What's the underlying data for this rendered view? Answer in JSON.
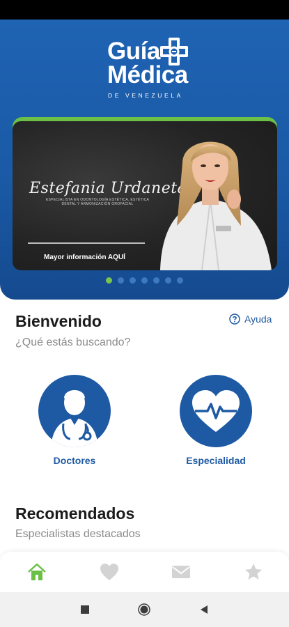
{
  "brand": {
    "line1": "Guía",
    "line2": "Médica",
    "subtitle": "DE VENEZUELA"
  },
  "banner": {
    "name": "Estefania Urdaneta",
    "specialty": "ESPECIALISTA EN ODONTOLOGÍA ESTÉTICA, ESTÉTICA DENTAL Y ARMONIZACIÓN OROFACIAL",
    "cta": "Mayor información AQUÍ"
  },
  "carousel": {
    "count": 7,
    "active_index": 0
  },
  "home": {
    "title": "Bienvenido",
    "subtitle": "¿Qué estás buscando?",
    "help_label": "Ayuda"
  },
  "categories": [
    {
      "label": "Doctores",
      "icon": "doctor-icon"
    },
    {
      "label": "Especialidad",
      "icon": "heart-pulse-icon"
    }
  ],
  "recommended": {
    "title": "Recomendados",
    "subtitle": "Especialistas destacados"
  },
  "bottom_nav": [
    {
      "icon": "home-icon",
      "active": true
    },
    {
      "icon": "heart-icon",
      "active": false
    },
    {
      "icon": "mail-icon",
      "active": false
    },
    {
      "icon": "star-icon",
      "active": false
    }
  ],
  "colors": {
    "primary": "#1e5aa3",
    "accent": "#6cc047",
    "muted": "#8a8a8a"
  }
}
